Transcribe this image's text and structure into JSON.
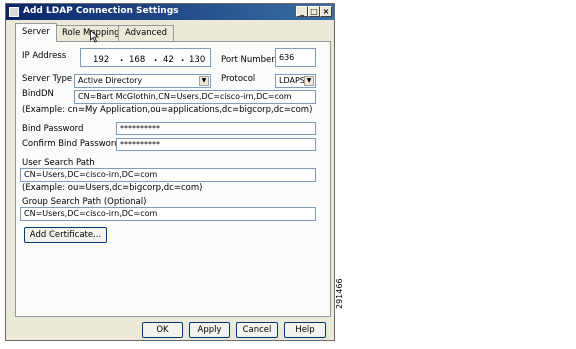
{
  "window": {
    "title": "Add LDAP Connection Settings",
    "minimize": "_",
    "maximize": "□",
    "close": "×"
  },
  "tabs": [
    {
      "label": "Server",
      "active": true
    },
    {
      "label": "Role Mapping",
      "active": false
    },
    {
      "label": "Advanced",
      "active": false
    }
  ],
  "form": {
    "ip_label": "IP Address",
    "ip_octets": [
      "192",
      "168",
      "42",
      "130"
    ],
    "ip_separator": ".",
    "port_label": "Port Number",
    "port_value": "636",
    "server_type_label": "Server Type",
    "server_type_value": "Active Directory",
    "protocol_label": "Protocol",
    "protocol_value": "LDAPS",
    "binddn_label": "BindDN",
    "binddn_value": "CN=Bart McGlothin,CN=Users,DC=cisco-irn,DC=com",
    "binddn_example": "(Example:  cn=My Application,ou=applications,dc=bigcorp,dc=com)",
    "bind_password_label": "Bind Password",
    "bind_password_value": "**********",
    "confirm_password_label": "Confirm Bind Password",
    "confirm_password_value": "**********",
    "user_search_label": "User Search Path",
    "user_search_value": "CN=Users,DC=cisco-irn,DC=com",
    "user_search_example": "(Example:  ou=Users,dc=bigcorp,dc=com)",
    "group_search_label": "Group Search Path (Optional)",
    "group_search_value": "CN=Users,DC=cisco-irn,DC=com",
    "add_certificate_label": "Add Certificate..."
  },
  "footer": {
    "ok": "OK",
    "apply": "Apply",
    "cancel": "Cancel",
    "help": "Help"
  },
  "figure_id": "291466",
  "colors": {
    "titlebar": "#0a246a",
    "field_border": "#7f9db9",
    "dialog_bg": "#ece9d8"
  }
}
